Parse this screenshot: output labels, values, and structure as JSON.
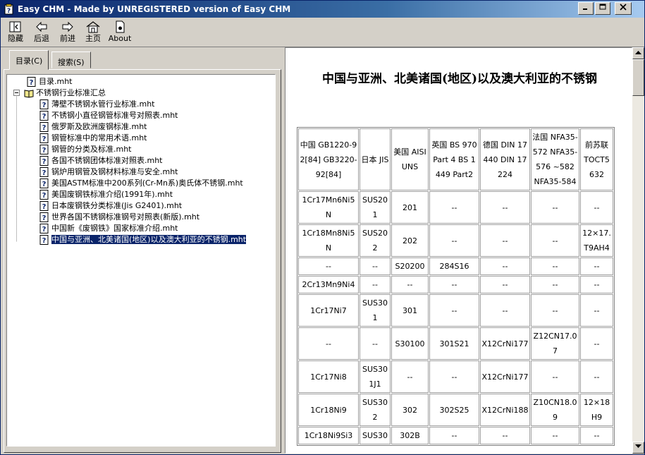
{
  "window": {
    "title": "Easy CHM - Made by UNREGISTERED version of Easy CHM",
    "controls": {
      "minimize": "0",
      "maximize": "1",
      "close": "r"
    }
  },
  "toolbar": [
    {
      "label": "隐藏",
      "icon": "hide-pane-icon"
    },
    {
      "label": "后退",
      "icon": "back-arrow-icon"
    },
    {
      "label": "前进",
      "icon": "forward-arrow-icon"
    },
    {
      "label": "主页",
      "icon": "home-icon"
    },
    {
      "label": "About",
      "icon": "about-document-icon"
    }
  ],
  "tabs": {
    "contents": "目录(C)",
    "search": "搜索(S)"
  },
  "tree": {
    "root_page": "目录.mht",
    "folder": "不锈钢行业标准汇总",
    "items": [
      "薄壁不锈钢水管行业标准.mht",
      "不锈钢小直径钢管标准号对照表.mht",
      "俄罗斯及欧洲废钢标准.mht",
      "钢管标准中的常用术语.mht",
      "钢管的分类及标准.mht",
      "各国不锈钢团体标准对照表.mht",
      "锅炉用钢管及钢材料标准与安全.mht",
      "美国ASTM标准中200系列(Cr-Mn系)奥氏体不锈钢.mht",
      "美国废钢铁标准介绍(1991年).mht",
      "日本废钢铁分类标准(Jis G2401).mht",
      "世界各国不锈钢标准钢号对照表(新版).mht",
      "中国新《废钢铁》国家标准介绍.mht",
      "中国与亚洲、北美诸国(地区)以及澳大利亚的不锈钢.mht"
    ],
    "selected_index": 12
  },
  "document": {
    "title": "中国与亚洲、北美诸国(地区)以及澳大利亚的不锈钢",
    "table": {
      "headers": [
        "中国 GB1220-92[84] GB3220-92[84]",
        "日本 JIS",
        "美国 AISI UNS",
        "英国 BS 970 Part 4 BS 1449 Part2",
        "德国 DIN 17440 DIN 17224",
        "法国 NFA35-572 NFA35-576 ~582 NFA35-584",
        "前苏联 TOCT5632"
      ],
      "rows": [
        [
          "1Cr17Mn6Ni5N",
          "SUS201",
          "201",
          "--",
          "--",
          "--",
          "--"
        ],
        [
          "1Cr18Mn8Ni5N",
          "SUS202",
          "202",
          "--",
          "--",
          "--",
          "12×17.T9AH4"
        ],
        [
          "--",
          "--",
          "S20200",
          "284S16",
          "--",
          "--",
          "--"
        ],
        [
          "2Cr13Mn9Ni4",
          "--",
          "--",
          "--",
          "--",
          "--",
          "--"
        ],
        [
          "1Cr17Ni7",
          "SUS301",
          "301",
          "--",
          "--",
          "--",
          "--"
        ],
        [
          "--",
          "--",
          "S30100",
          "301S21",
          "X12CrNi177",
          "Z12CN17.07",
          "--"
        ],
        [
          "1Cr17Ni8",
          "SUS301J1",
          "--",
          "--",
          "X12CrNi177",
          "--",
          "--"
        ],
        [
          "1Cr18Ni9",
          "SUS302",
          "302",
          "302S25",
          "X12CrNi188",
          "Z10CN18.09",
          "12×18H9"
        ],
        [
          "1Cr18Ni9Si3",
          "SUS30",
          "302B",
          "--",
          "--",
          "--",
          "--"
        ]
      ]
    }
  },
  "colors": {
    "titlebar_start": "#0a246a",
    "titlebar_end": "#a6caf0",
    "face": "#d4d0c8",
    "selection": "#0a246a"
  }
}
